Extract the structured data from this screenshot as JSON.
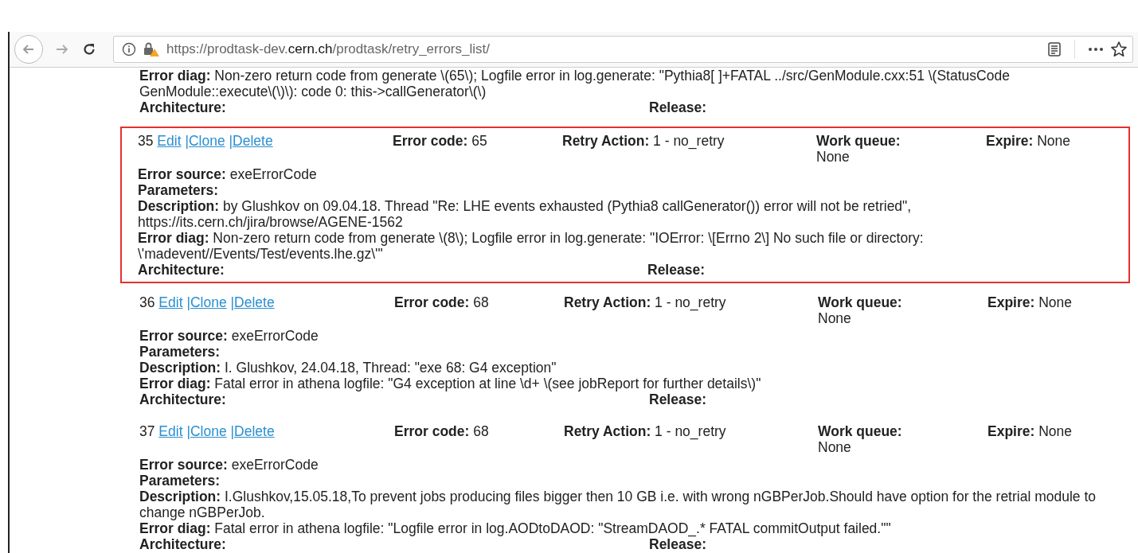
{
  "browser": {
    "url": {
      "before": "https://prodtask-dev.",
      "domain": "cern.ch",
      "after": "/prodtask/retry_errors_list/"
    }
  },
  "records": [
    {
      "selected": false,
      "lines": [
        {
          "label": "Error diag:",
          "value": "Non-zero return code from generate \\(65\\); Logfile error in log.generate: \"Pythia8[ ]+FATAL ../src/GenModule.cxx:51 \\(StatusCode GenModule::execute\\(\\)\\): code 0: this->callGenerator\\(\\)"
        }
      ],
      "footer": [
        {
          "label": "Architecture:"
        },
        {
          "label": "Release:"
        }
      ]
    },
    {
      "selected": true,
      "id": "35",
      "links": [
        "Edit",
        "|Clone",
        "|Delete"
      ],
      "header": [
        {
          "label": "Error code:",
          "value": "65"
        },
        {
          "label": "Retry Action:",
          "value": "1 - no_retry"
        },
        {
          "label": "Work queue:",
          "value": "None"
        },
        {
          "label": "Expire:",
          "value": "None"
        }
      ],
      "lines": [
        {
          "label": "Error source:",
          "value": "exeErrorCode"
        },
        {
          "label": "Parameters:"
        },
        {
          "label": "Description:",
          "value": "by Glushkov on 09.04.18. Thread \"Re: LHE events exhausted (Pythia8 callGenerator()) error will not be retried\", https://its.cern.ch/jira/browse/AGENE-1562"
        },
        {
          "label": "Error diag:",
          "value": "Non-zero return code from generate \\(8\\); Logfile error in log.generate: \"IOError: \\[Errno 2\\] No such file or directory: \\'madevent//Events/Test/events.lhe.gz\\'\""
        }
      ],
      "footer": [
        {
          "label": "Architecture:"
        },
        {
          "label": "Release:"
        }
      ]
    },
    {
      "selected": false,
      "id": "36",
      "links": [
        "Edit",
        "|Clone",
        "|Delete"
      ],
      "header": [
        {
          "label": "Error code:",
          "value": "68"
        },
        {
          "label": "Retry Action:",
          "value": "1 - no_retry"
        },
        {
          "label": "Work queue:",
          "value": "None"
        },
        {
          "label": "Expire:",
          "value": "None"
        }
      ],
      "lines": [
        {
          "label": "Error source:",
          "value": "exeErrorCode"
        },
        {
          "label": "Parameters:"
        },
        {
          "label": "Description:",
          "value": "I. Glushkov, 24.04.18, Thread: \"exe 68: G4 exception\""
        },
        {
          "label": "Error diag:",
          "value": "Fatal error in athena logfile: \"G4 exception at line \\d+ \\(see jobReport for further details\\)\""
        }
      ],
      "footer": [
        {
          "label": "Architecture:"
        },
        {
          "label": "Release:"
        }
      ]
    },
    {
      "selected": false,
      "id": "37",
      "links": [
        "Edit",
        "|Clone",
        "|Delete"
      ],
      "header": [
        {
          "label": "Error code:",
          "value": "68"
        },
        {
          "label": "Retry Action:",
          "value": "1 - no_retry"
        },
        {
          "label": "Work queue:",
          "value": "None"
        },
        {
          "label": "Expire:",
          "value": "None"
        }
      ],
      "lines": [
        {
          "label": "Error source:",
          "value": "exeErrorCode"
        },
        {
          "label": "Parameters:"
        },
        {
          "label": "Description:",
          "value": "I.Glushkov,15.05.18,To prevent jobs producing files bigger then 10 GB i.e. with wrong nGBPerJob.Should have option for the retrial module to change nGBPerJob."
        },
        {
          "label": "Error diag:",
          "value": "Fatal error in athena logfile: \"Logfile error in log.AODtoDAOD: \"StreamDAOD_.* FATAL commitOutput failed.\"\""
        }
      ],
      "footer": [
        {
          "label": "Architecture:"
        },
        {
          "label": "Release:"
        }
      ]
    }
  ]
}
